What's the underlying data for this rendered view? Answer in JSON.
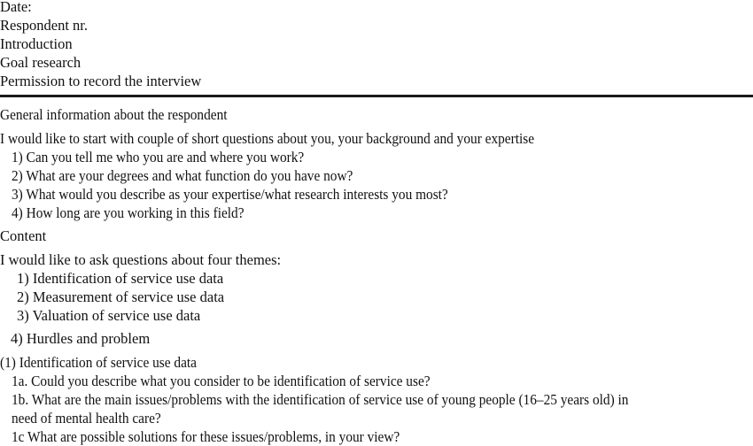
{
  "header": {
    "date_label": "Date:",
    "respondent_label": "Respondent nr.",
    "introduction_label": "Introduction",
    "goal_label": "Goal research",
    "permission_label": "Permission to record the interview"
  },
  "general": {
    "heading": "General information about the respondent",
    "intro": "I would like to start with couple of short questions about you, your background and your expertise",
    "questions": [
      "1) Can you tell me who you are and where you work?",
      "2)  What are your degrees and what function do you have now?",
      "3) What would you describe as your expertise/what research interests you most?",
      "4) How long are you working in this field?"
    ]
  },
  "content": {
    "heading": "Content",
    "intro": "I would like to ask questions about four themes:",
    "themes": [
      "1) Identification of service use data",
      "2) Measurement of service use data",
      "3) Valuation of service use data",
      "4) Hurdles and problem"
    ]
  },
  "section1": {
    "heading": "(1) Identification of service use data",
    "q1a": "1a. Could you describe what you consider to be identification of service use?",
    "q1b_line1": "1b. What are the main issues/problems with the identification of service use of young people (16–25 years old) in",
    "q1b_line2": "need of mental health care?",
    "q1c": "1c What are possible solutions for these issues/problems, in your view?"
  }
}
